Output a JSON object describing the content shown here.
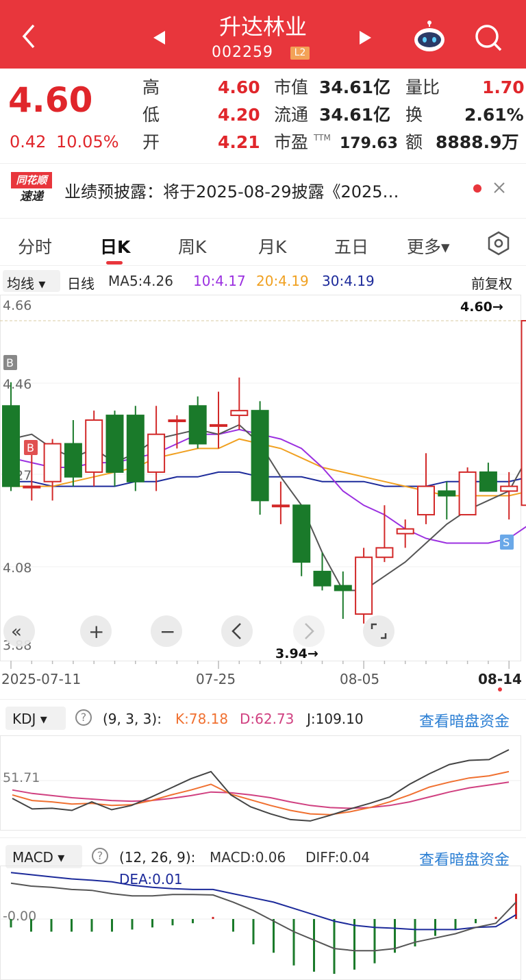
{
  "header": {
    "title": "升达林业",
    "code": "002259",
    "level_badge": "L2",
    "bg_color": "#e8363c"
  },
  "quote": {
    "price": "4.60",
    "change": "0.42",
    "change_pct": "10.05%",
    "high_label": "高",
    "high": "4.60",
    "low_label": "低",
    "low": "4.20",
    "open_label": "开",
    "open": "4.21",
    "mcap_label": "市值",
    "mcap": "34.61亿",
    "float_label": "流通",
    "float": "34.61亿",
    "pe_label": "市盈",
    "pe_sup": "TTM",
    "pe": "179.63",
    "volratio_label": "量比",
    "volratio": "1.70",
    "turnover_label": "换",
    "turnover": "2.61%",
    "amount_label": "额",
    "amount": "8888.9万"
  },
  "news": {
    "badge_top": "同花顺",
    "badge_bottom": "速递",
    "text": "业绩预披露：将于2025-08-29披露《2025…"
  },
  "tabs": [
    "分时",
    "日K",
    "周K",
    "月K",
    "五日",
    "更多▾"
  ],
  "active_tab": "日K",
  "ma": {
    "dropdown": "均线 ▾",
    "period": "日线",
    "ma5": "MA5:4.26",
    "ma10": "10:4.17",
    "ma20": "20:4.19",
    "ma30": "30:4.19",
    "adjust": "前复权"
  },
  "kline": {
    "y_labels": [
      "4.66",
      "4.46",
      "4.27",
      "4.08",
      "3.88"
    ],
    "high_marker": "4.60→",
    "low_marker": "3.94→",
    "b_label": "B",
    "s_label": "S",
    "dates": [
      "2025-07-11",
      "07-25",
      "08-05",
      "08-14"
    ],
    "candles": [
      {
        "o": 4.42,
        "c": 4.25,
        "h": 4.47,
        "l": 4.24
      },
      {
        "o": 4.25,
        "c": 4.25,
        "h": 4.33,
        "l": 4.22
      },
      {
        "o": 4.26,
        "c": 4.34,
        "h": 4.35,
        "l": 4.22
      },
      {
        "o": 4.34,
        "c": 4.27,
        "h": 4.39,
        "l": 4.25
      },
      {
        "o": 4.28,
        "c": 4.39,
        "h": 4.41,
        "l": 4.25
      },
      {
        "o": 4.4,
        "c": 4.28,
        "h": 4.41,
        "l": 4.25
      },
      {
        "o": 4.4,
        "c": 4.26,
        "h": 4.42,
        "l": 4.24
      },
      {
        "o": 4.28,
        "c": 4.36,
        "h": 4.42,
        "l": 4.24
      },
      {
        "o": 4.39,
        "c": 4.39,
        "h": 4.4,
        "l": 4.33
      },
      {
        "o": 4.42,
        "c": 4.34,
        "h": 4.44,
        "l": 4.33
      },
      {
        "o": 4.38,
        "c": 4.38,
        "h": 4.45,
        "l": 4.33
      },
      {
        "o": 4.4,
        "c": 4.41,
        "h": 4.48,
        "l": 4.37
      },
      {
        "o": 4.41,
        "c": 4.22,
        "h": 4.43,
        "l": 4.19
      },
      {
        "o": 4.21,
        "c": 4.21,
        "h": 4.26,
        "l": 4.17
      },
      {
        "o": 4.21,
        "c": 4.09,
        "h": 4.21,
        "l": 4.06
      },
      {
        "o": 4.07,
        "c": 4.04,
        "h": 4.11,
        "l": 4.03
      },
      {
        "o": 4.04,
        "c": 4.03,
        "h": 4.07,
        "l": 3.97
      },
      {
        "o": 3.98,
        "c": 4.1,
        "h": 4.12,
        "l": 3.96
      },
      {
        "o": 4.1,
        "c": 4.12,
        "h": 4.21,
        "l": 4.09
      },
      {
        "o": 4.15,
        "c": 4.16,
        "h": 4.18,
        "l": 4.12
      },
      {
        "o": 4.19,
        "c": 4.25,
        "h": 4.32,
        "l": 4.17
      },
      {
        "o": 4.24,
        "c": 4.23,
        "h": 4.26,
        "l": 4.18
      },
      {
        "o": 4.19,
        "c": 4.28,
        "h": 4.29,
        "l": 4.19
      },
      {
        "o": 4.28,
        "c": 4.24,
        "h": 4.3,
        "l": 4.24
      },
      {
        "o": 4.24,
        "c": 4.25,
        "h": 4.28,
        "l": 4.18
      },
      {
        "o": 4.21,
        "c": 4.6,
        "h": 4.6,
        "l": 4.2
      }
    ],
    "ma5_values": [
      4.35,
      4.36,
      4.33,
      4.31,
      4.33,
      4.3,
      4.32,
      4.35,
      4.36,
      4.37,
      4.36,
      4.38,
      4.34,
      4.27,
      4.21,
      4.11,
      4.03,
      4.03,
      4.06,
      4.09,
      4.13,
      4.17,
      4.2,
      4.22,
      4.24,
      4.32
    ],
    "ma10_values": [
      4.31,
      4.3,
      4.29,
      4.29,
      4.3,
      4.3,
      4.31,
      4.32,
      4.34,
      4.36,
      4.36,
      4.37,
      4.36,
      4.35,
      4.33,
      4.29,
      4.24,
      4.21,
      4.19,
      4.16,
      4.14,
      4.13,
      4.13,
      4.13,
      4.14,
      4.17
    ],
    "ma20_values": [
      4.25,
      4.25,
      4.25,
      4.26,
      4.27,
      4.28,
      4.29,
      4.31,
      4.32,
      4.33,
      4.33,
      4.35,
      4.34,
      4.33,
      4.31,
      4.29,
      4.28,
      4.27,
      4.26,
      4.25,
      4.24,
      4.23,
      4.23,
      4.23,
      4.23,
      4.24
    ],
    "ma30_values": [
      4.26,
      4.26,
      4.25,
      4.25,
      4.25,
      4.25,
      4.26,
      4.26,
      4.27,
      4.27,
      4.28,
      4.28,
      4.27,
      4.27,
      4.27,
      4.26,
      4.26,
      4.26,
      4.25,
      4.25,
      4.25,
      4.26,
      4.26,
      4.26,
      4.26,
      4.27
    ],
    "colors": {
      "up": "#d22828",
      "down": "#1a7a2a",
      "ma5": "#555555",
      "ma10": "#9b30e0",
      "ma20": "#f0a020",
      "ma30": "#1c2a9a"
    }
  },
  "kdj": {
    "dropdown": "KDJ ▾",
    "params": "(9, 3, 3):",
    "k": "K:78.18",
    "d": "D:62.73",
    "j": "J:109.10",
    "link": "查看暗盘资金",
    "ref_label": "51.71",
    "j_values": [
      40,
      25,
      26,
      23,
      35,
      24,
      30,
      42,
      55,
      68,
      78,
      45,
      28,
      18,
      10,
      8,
      16,
      25,
      33,
      42,
      60,
      75,
      88,
      94,
      95,
      109
    ],
    "k_values": [
      45,
      37,
      35,
      32,
      33,
      30,
      31,
      37,
      45,
      52,
      60,
      46,
      38,
      30,
      23,
      18,
      17,
      21,
      27,
      35,
      45,
      56,
      63,
      69,
      72,
      78
    ],
    "d_values": [
      52,
      47,
      44,
      41,
      39,
      37,
      36,
      37,
      40,
      44,
      49,
      48,
      45,
      41,
      35,
      30,
      27,
      26,
      27,
      30,
      35,
      42,
      49,
      55,
      59,
      63
    ]
  },
  "macd": {
    "dropdown": "MACD ▾",
    "params": "(12, 26, 9):",
    "macd": "MACD:0.06",
    "diff": "DIFF:0.04",
    "dea": "DEA:0.01",
    "link": "查看暗盘资金",
    "ref_label": "-0.00",
    "diff_values": [
      0.085,
      0.078,
      0.075,
      0.07,
      0.068,
      0.06,
      0.055,
      0.055,
      0.058,
      0.058,
      0.057,
      0.04,
      0.02,
      -0.005,
      -0.03,
      -0.05,
      -0.07,
      -0.075,
      -0.075,
      -0.07,
      -0.055,
      -0.045,
      -0.035,
      -0.02,
      -0.01,
      0.04
    ],
    "dea_values": [
      0.11,
      0.105,
      0.1,
      0.095,
      0.092,
      0.088,
      0.08,
      0.075,
      0.072,
      0.07,
      0.07,
      0.06,
      0.05,
      0.04,
      0.025,
      0.01,
      -0.005,
      -0.015,
      -0.02,
      -0.022,
      -0.025,
      -0.025,
      -0.025,
      -0.02,
      -0.018,
      0.01
    ],
    "hist_values": [
      -0.02,
      -0.03,
      -0.03,
      -0.03,
      -0.03,
      -0.03,
      -0.025,
      -0.02,
      -0.015,
      -0.01,
      0.005,
      -0.03,
      -0.06,
      -0.08,
      -0.11,
      -0.125,
      -0.13,
      -0.12,
      -0.105,
      -0.08,
      -0.065,
      -0.04,
      -0.025,
      -0.01,
      0.005,
      0.06
    ]
  }
}
